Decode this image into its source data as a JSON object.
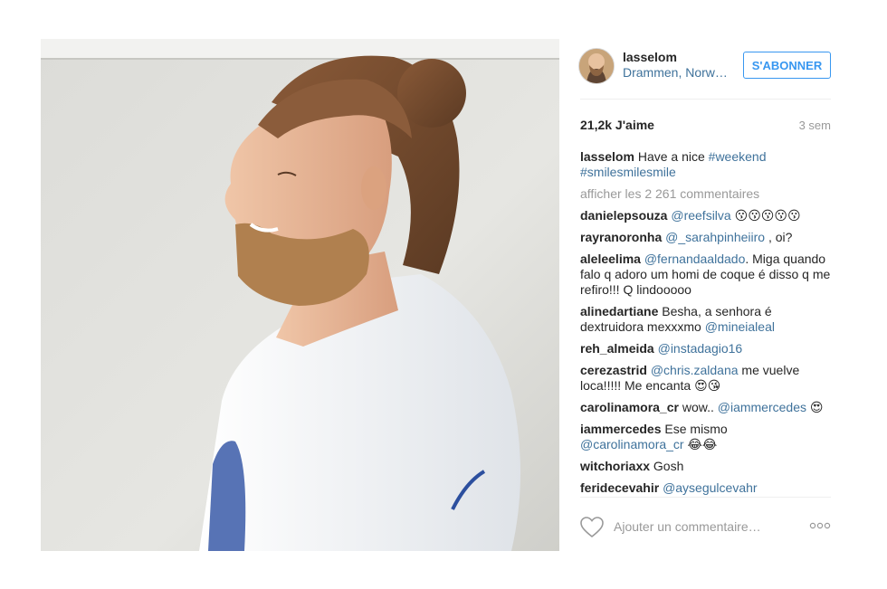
{
  "post": {
    "username": "lasselom",
    "location": "Drammen, Norw…",
    "follow_label": "S'ABONNER",
    "likes": "21,2k J'aime",
    "time": "3 sem",
    "caption": {
      "user": "lasselom",
      "text": "Have a nice ",
      "tag1": "#weekend",
      "tag2": "#smilesmilesmile"
    },
    "more_comments": "afficher les 2 261 commentaires",
    "comments": [
      {
        "user": "danielepsouza",
        "parts": [
          {
            "t": "@reefsilva",
            "tag": true
          },
          {
            "t": " 😗😗😗😗😗"
          }
        ]
      },
      {
        "user": "rayranoronha",
        "parts": [
          {
            "t": "@_sarahpinheiiro",
            "tag": true
          },
          {
            "t": " , oi?"
          }
        ]
      },
      {
        "user": "aleleelima",
        "parts": [
          {
            "t": "@fernandaaldado",
            "tag": true
          },
          {
            "t": ". Miga quando falo q adoro um homi de coque é disso q me refiro!!! Q lindooooo"
          }
        ]
      },
      {
        "user": "alinedartiane",
        "parts": [
          {
            "t": "Besha, a senhora é dextruidora mexxxmo "
          },
          {
            "t": "@mineialeal",
            "tag": true
          }
        ]
      },
      {
        "user": "reh_almeida",
        "parts": [
          {
            "t": "@instadagio16",
            "tag": true
          }
        ]
      },
      {
        "user": "cerezastrid",
        "parts": [
          {
            "t": "@chris.zaldana",
            "tag": true
          },
          {
            "t": " me vuelve loca!!!!! Me encanta 😍😘"
          }
        ]
      },
      {
        "user": "carolinamora_cr",
        "parts": [
          {
            "t": "wow.. "
          },
          {
            "t": "@iammercedes",
            "tag": true
          },
          {
            "t": " 😍"
          }
        ]
      },
      {
        "user": "iammercedes",
        "parts": [
          {
            "t": "Ese mismo "
          },
          {
            "t": "@carolinamora_cr",
            "tag": true
          },
          {
            "t": " 😂😂"
          }
        ]
      },
      {
        "user": "witchoriaxx",
        "parts": [
          {
            "t": "Gosh"
          }
        ]
      },
      {
        "user": "feridecevahir",
        "parts": [
          {
            "t": "@aysegulcevahr",
            "tag": true
          }
        ]
      }
    ],
    "add_comment_placeholder": "Ajouter un commentaire…",
    "icons": {
      "like": "heart-icon",
      "options": "more-options-icon"
    },
    "colors": {
      "accent": "#3897f0",
      "link": "#3f729b",
      "muted": "#999999"
    }
  }
}
